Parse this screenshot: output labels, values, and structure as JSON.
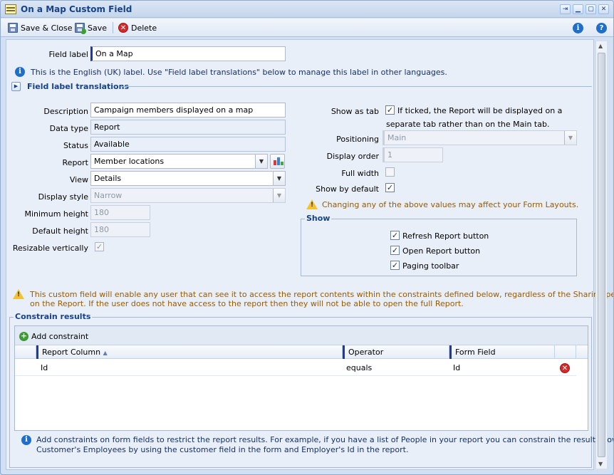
{
  "window": {
    "title": "On a Map Custom Field",
    "buttons": [
      "pin",
      "minimize",
      "maximize",
      "close"
    ]
  },
  "toolbar": {
    "save_close_label": "Save & Close",
    "save_label": "Save",
    "delete_label": "Delete"
  },
  "form": {
    "field_label": {
      "label": "Field label",
      "value": "On a Map"
    },
    "field_label_info": "This is the English (UK) label. Use \"Field label translations\" below to manage this label in other languages.",
    "translations_title": "Field label translations",
    "description": {
      "label": "Description",
      "value": "Campaign members displayed on a map"
    },
    "data_type": {
      "label": "Data type",
      "value": "Report"
    },
    "status": {
      "label": "Status",
      "value": "Available"
    },
    "report": {
      "label": "Report",
      "value": "Member locations"
    },
    "view": {
      "label": "View",
      "value": "Details"
    },
    "display_style": {
      "label": "Display style",
      "value": "Narrow"
    },
    "minimum_height": {
      "label": "Minimum height",
      "value": "180"
    },
    "default_height": {
      "label": "Default height",
      "value": "180"
    },
    "resizable_vertically": {
      "label": "Resizable vertically",
      "checked": true
    },
    "show_as_tab": {
      "label": "Show as tab",
      "checked": true,
      "text_line1": "If ticked, the Report will be displayed on a",
      "text_line2": "separate tab rather than on the Main tab."
    },
    "positioning": {
      "label": "Positioning",
      "value": "Main"
    },
    "display_order": {
      "label": "Display order",
      "value": "1"
    },
    "full_width": {
      "label": "Full width",
      "checked": false
    },
    "show_by_default": {
      "label": "Show by default",
      "checked": true
    },
    "layout_warning": "Changing any of the above values may affect your Form Layouts.",
    "show_group": {
      "title": "Show",
      "refresh_button": {
        "label": "Refresh Report button",
        "checked": true
      },
      "open_button": {
        "label": "Open Report button",
        "checked": true
      },
      "paging_toolbar": {
        "label": "Paging toolbar",
        "checked": true
      }
    },
    "access_warning_line1": "This custom field will enable any user that can see it to access the report contents within the constraints defined below, regardless of the Sharing permissions",
    "access_warning_line2": "on the Report. If the user does not have access to the report then they will not be able to open the full Report."
  },
  "constraints": {
    "title": "Constrain results",
    "add_label": "Add constraint",
    "columns": [
      "Report Column",
      "Operator",
      "Form Field"
    ],
    "rows": [
      {
        "report_column": "Id",
        "operator": "equals",
        "form_field": "Id"
      }
    ],
    "info_line1": "Add constraints on form fields to restrict the report results. For example, if you have a list of People in your report you can constrain the results down to the",
    "info_line2": "Customer's Employees by using the customer field in the form and Employer's Id in the report."
  }
}
